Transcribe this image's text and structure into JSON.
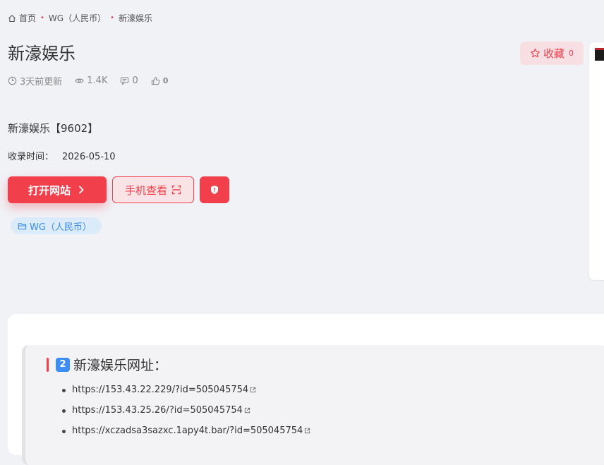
{
  "breadcrumb": {
    "home": "首页",
    "category": "WG（人民币）",
    "current": "新濠娱乐"
  },
  "title": "新濠娱乐",
  "meta": {
    "updated": "3天前更新",
    "views": "1.4K",
    "comments": "0",
    "likes": "0"
  },
  "favorite": {
    "label": "收藏",
    "count": "0"
  },
  "site_name": "新濠娱乐【9602】",
  "added": {
    "label": "收录时间：",
    "value": "2026-05-10"
  },
  "buttons": {
    "open": "打开网站",
    "mobile": "手机查看"
  },
  "tag": "WG（人民币）",
  "content": {
    "heading_num": "2",
    "heading": "新濠娱乐网址：",
    "links": [
      "https://153.43.22.229/?id=505045754",
      "https://153.43.25.26/?id=505045754",
      "https://xczadsa3sazxc.1apy4t.bar/?id=505045754"
    ]
  },
  "colors": {
    "accent": "#f1404b",
    "tag_blue": "#3a8ee6",
    "num_badge": "#3d8df5"
  }
}
